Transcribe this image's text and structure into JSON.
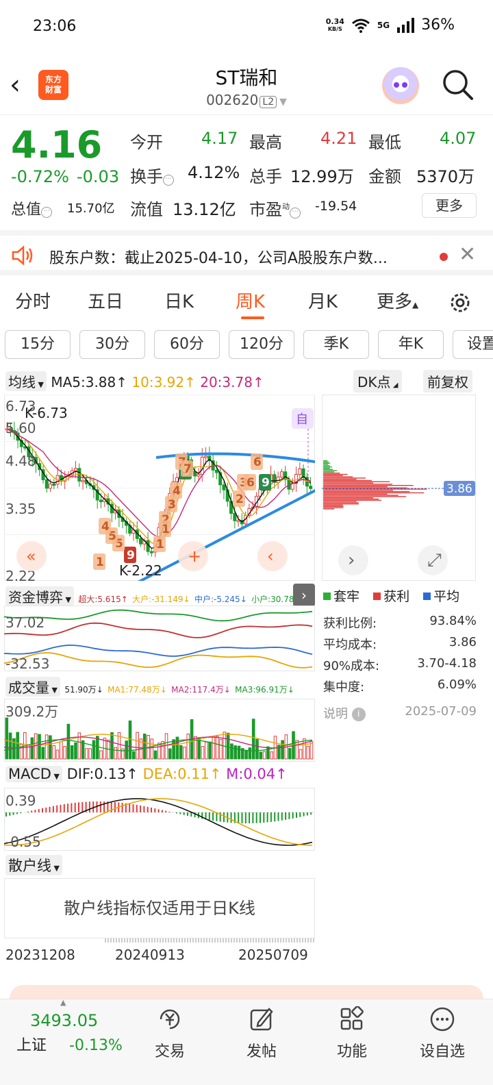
{
  "status": {
    "time": "23:06",
    "speed_top": "0.34",
    "speed_bottom": "KB/S",
    "network": "5G",
    "battery": "36%"
  },
  "header": {
    "logo_line1": "东方",
    "logo_line2": "财富",
    "name": "ST瑞和",
    "code": "002620",
    "level": "L2"
  },
  "quote": {
    "price": "4.16",
    "change_pct": "-0.72%",
    "change": "-0.03",
    "open_label": "今开",
    "open": "4.17",
    "high_label": "最高",
    "high": "4.21",
    "low_label": "最低",
    "low": "4.07",
    "turnover_label": "换手",
    "turnover": "4.12%",
    "volume_label": "总手",
    "volume": "12.99万",
    "amount_label": "金额",
    "amount": "5370万",
    "mcap_label": "总值",
    "mcap": "15.70亿",
    "float_label": "流值",
    "float_cap": "13.12亿",
    "pe_label": "市盈",
    "pe_sup": "动",
    "pe": "-19.54",
    "more": "更多"
  },
  "news": {
    "text": "股东户数：截止2025-04-10，公司A股股东户数..."
  },
  "tabs": [
    "分时",
    "五日",
    "日K",
    "周K",
    "月K",
    "更多"
  ],
  "periods": [
    "15分",
    "30分",
    "60分",
    "120分",
    "季K",
    "年K",
    "设置"
  ],
  "ma_row": {
    "select": "均线",
    "ma5": "MA5:3.88",
    "ma10": "10:3.92",
    "ma20": "20:3.78",
    "dk": "DK点",
    "fq": "前复权"
  },
  "kchart": {
    "y_labels": [
      "6.73",
      "5.60",
      "4.48",
      "3.35",
      "2.22"
    ],
    "high_note": "6.73",
    "low_note": "2.22",
    "self_tag": "自",
    "price_tag": "3.86",
    "markers": [
      "9",
      "9",
      "9",
      "7",
      "6",
      "4",
      "3",
      "2",
      "1",
      "5",
      "3",
      "2",
      "1",
      "6",
      "5",
      "4",
      "7",
      "1"
    ]
  },
  "capital_row": {
    "select": "资金博弈",
    "super": "超大:5.615",
    "big": "大户:-31.149",
    "mid": "中户:-5.245",
    "small": "小户:30.780"
  },
  "capital_chart": {
    "y_top": "37.02",
    "y_bottom": "-32.53"
  },
  "volume_row": {
    "select": "成交量",
    "vol": "51.90万",
    "ma1": "MA1:77.48万",
    "ma2": "MA2:117.4万",
    "ma3": "MA3:96.91万"
  },
  "volume_chart": {
    "y_top": "309.2万"
  },
  "macd_row": {
    "select": "MACD",
    "dif": "DIF:0.13",
    "dea": "DEA:0.11",
    "m": "M:0.04"
  },
  "macd_chart": {
    "y_top": "0.39",
    "y_bottom": "-0.55"
  },
  "retail_row": {
    "select": "散户线",
    "notice": "散户线指标仅适用于日K线"
  },
  "x_dates": [
    "20231208",
    "20240913",
    "20250709"
  ],
  "chips_legend": {
    "trapped": "套牢",
    "profit": "获利",
    "avg": "平均"
  },
  "chips_stats": [
    {
      "label": "获利比例:",
      "value": "93.84%"
    },
    {
      "label": "平均成本:",
      "value": "3.86"
    },
    {
      "label": "90%成本:",
      "value": "3.70-4.18"
    },
    {
      "label": "集中度:",
      "value": "6.09%"
    }
  ],
  "chips_note": {
    "label": "说明",
    "date": "2025-07-09"
  },
  "bottom_nav": {
    "index_value": "3493.05",
    "index_name": "上证",
    "index_change": "-0.13%",
    "trade": "交易",
    "post": "发帖",
    "func": "功能",
    "custom": "设自选"
  },
  "colors": {
    "accent": "#ff5a1f",
    "up": "#e23b3b",
    "down": "#1a9a2a"
  }
}
